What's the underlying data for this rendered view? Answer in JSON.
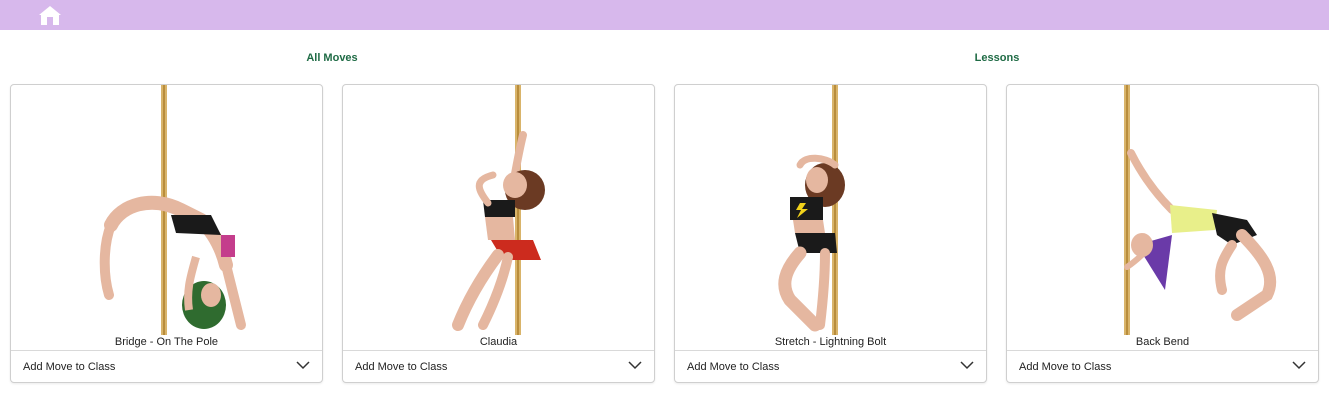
{
  "header": {
    "home_icon": "home-icon",
    "bar_color": "#d7b8ec"
  },
  "nav": {
    "all_moves": "All Moves",
    "lessons": "Lessons",
    "link_color": "#1f6b45"
  },
  "cards": [
    {
      "title": "Bridge - On The Pole",
      "select_label": "Add Move to Class"
    },
    {
      "title": "Claudia",
      "select_label": "Add Move to Class"
    },
    {
      "title": "Stretch - Lightning Bolt",
      "select_label": "Add Move to Class"
    },
    {
      "title": "Back Bend",
      "select_label": "Add Move to Class"
    }
  ]
}
